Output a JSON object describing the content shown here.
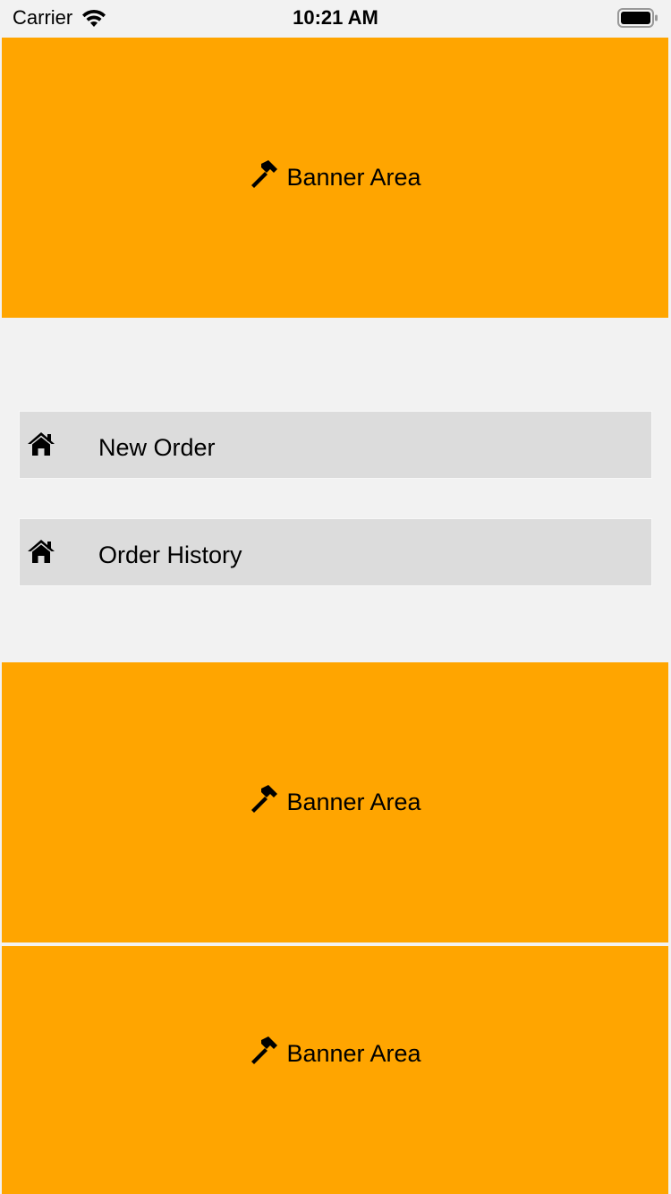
{
  "status_bar": {
    "carrier": "Carrier",
    "time": "10:21 AM",
    "wifi_icon": "wifi-icon",
    "battery_icon": "battery-icon"
  },
  "banners": [
    {
      "label": "Banner Area",
      "icon": "hammer-icon"
    },
    {
      "label": "Banner Area",
      "icon": "hammer-icon"
    },
    {
      "label": "Banner Area",
      "icon": "hammer-icon"
    }
  ],
  "menu": {
    "items": [
      {
        "label": "New Order",
        "icon": "home-icon"
      },
      {
        "label": "Order History",
        "icon": "home-icon"
      }
    ]
  },
  "colors": {
    "banner_background": "#ffa500",
    "menu_item_background": "#dcdcdc",
    "page_background": "#f2f2f2"
  }
}
